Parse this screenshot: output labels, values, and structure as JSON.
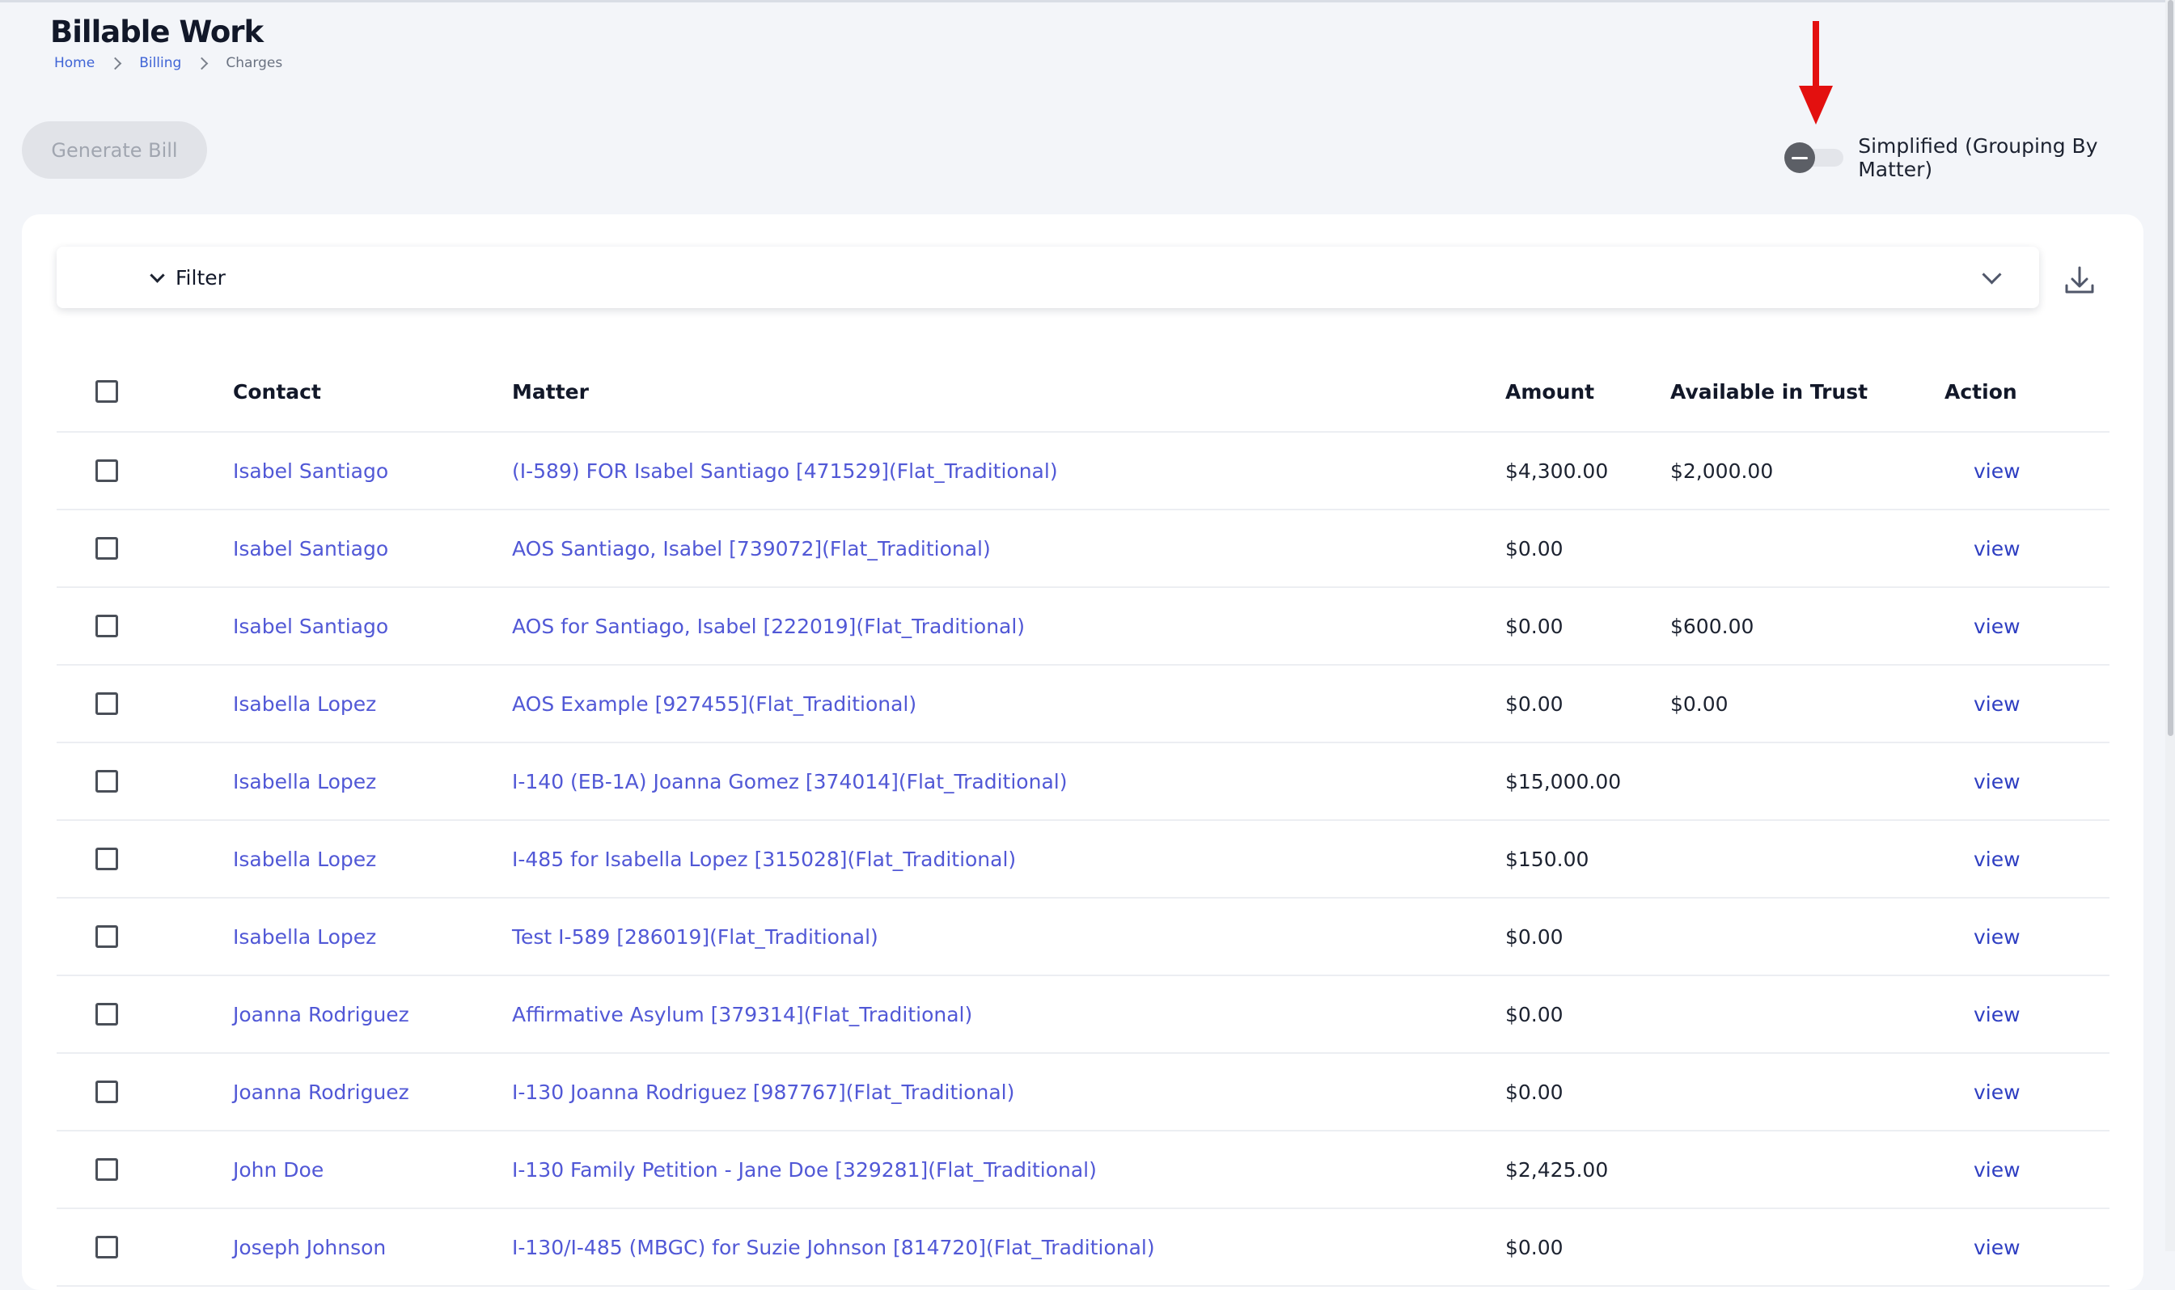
{
  "page": {
    "title": "Billable Work",
    "breadcrumb": [
      "Home",
      "Billing",
      "Charges"
    ]
  },
  "toolbar": {
    "generate_bill_label": "Generate Bill",
    "toggle_label": "Simplified (Grouping By Matter)",
    "toggle_on": false
  },
  "filter": {
    "label": "Filter"
  },
  "table": {
    "columns": [
      "Contact",
      "Matter",
      "Amount",
      "Available in Trust",
      "Action"
    ],
    "rows": [
      {
        "contact": "Isabel Santiago",
        "matter": "(I-589) FOR Isabel Santiago [471529](Flat_Traditional)",
        "amount": "$4,300.00",
        "trust": "$2,000.00",
        "action": "view"
      },
      {
        "contact": "Isabel Santiago",
        "matter": "AOS Santiago, Isabel [739072](Flat_Traditional)",
        "amount": "$0.00",
        "trust": "",
        "action": "view"
      },
      {
        "contact": "Isabel Santiago",
        "matter": "AOS for Santiago, Isabel [222019](Flat_Traditional)",
        "amount": "$0.00",
        "trust": "$600.00",
        "action": "view"
      },
      {
        "contact": "Isabella Lopez",
        "matter": "AOS Example [927455](Flat_Traditional)",
        "amount": "$0.00",
        "trust": "$0.00",
        "action": "view"
      },
      {
        "contact": "Isabella Lopez",
        "matter": "I-140 (EB-1A) Joanna Gomez [374014](Flat_Traditional)",
        "amount": "$15,000.00",
        "trust": "",
        "action": "view"
      },
      {
        "contact": "Isabella Lopez",
        "matter": "I-485 for Isabella Lopez [315028](Flat_Traditional)",
        "amount": "$150.00",
        "trust": "",
        "action": "view"
      },
      {
        "contact": "Isabella Lopez",
        "matter": "Test I-589 [286019](Flat_Traditional)",
        "amount": "$0.00",
        "trust": "",
        "action": "view"
      },
      {
        "contact": "Joanna Rodriguez",
        "matter": "Affirmative Asylum [379314](Flat_Traditional)",
        "amount": "$0.00",
        "trust": "",
        "action": "view"
      },
      {
        "contact": "Joanna Rodriguez",
        "matter": "I-130 Joanna Rodriguez [987767](Flat_Traditional)",
        "amount": "$0.00",
        "trust": "",
        "action": "view"
      },
      {
        "contact": "John Doe",
        "matter": "I-130 Family Petition - Jane Doe [329281](Flat_Traditional)",
        "amount": "$2,425.00",
        "trust": "",
        "action": "view"
      },
      {
        "contact": "Joseph Johnson",
        "matter": "I-130/I-485 (MBGC) for Suzie Johnson [814720](Flat_Traditional)",
        "amount": "$0.00",
        "trust": "",
        "action": "view"
      }
    ]
  },
  "colors": {
    "link": "#5158d6",
    "view_link": "#2f3fc2",
    "annotation_arrow": "#e3100f"
  },
  "icons": [
    "chevron-right-icon",
    "toggle-dash-icon",
    "chevron-down-icon",
    "download-icon",
    "red-arrow-annotation"
  ]
}
